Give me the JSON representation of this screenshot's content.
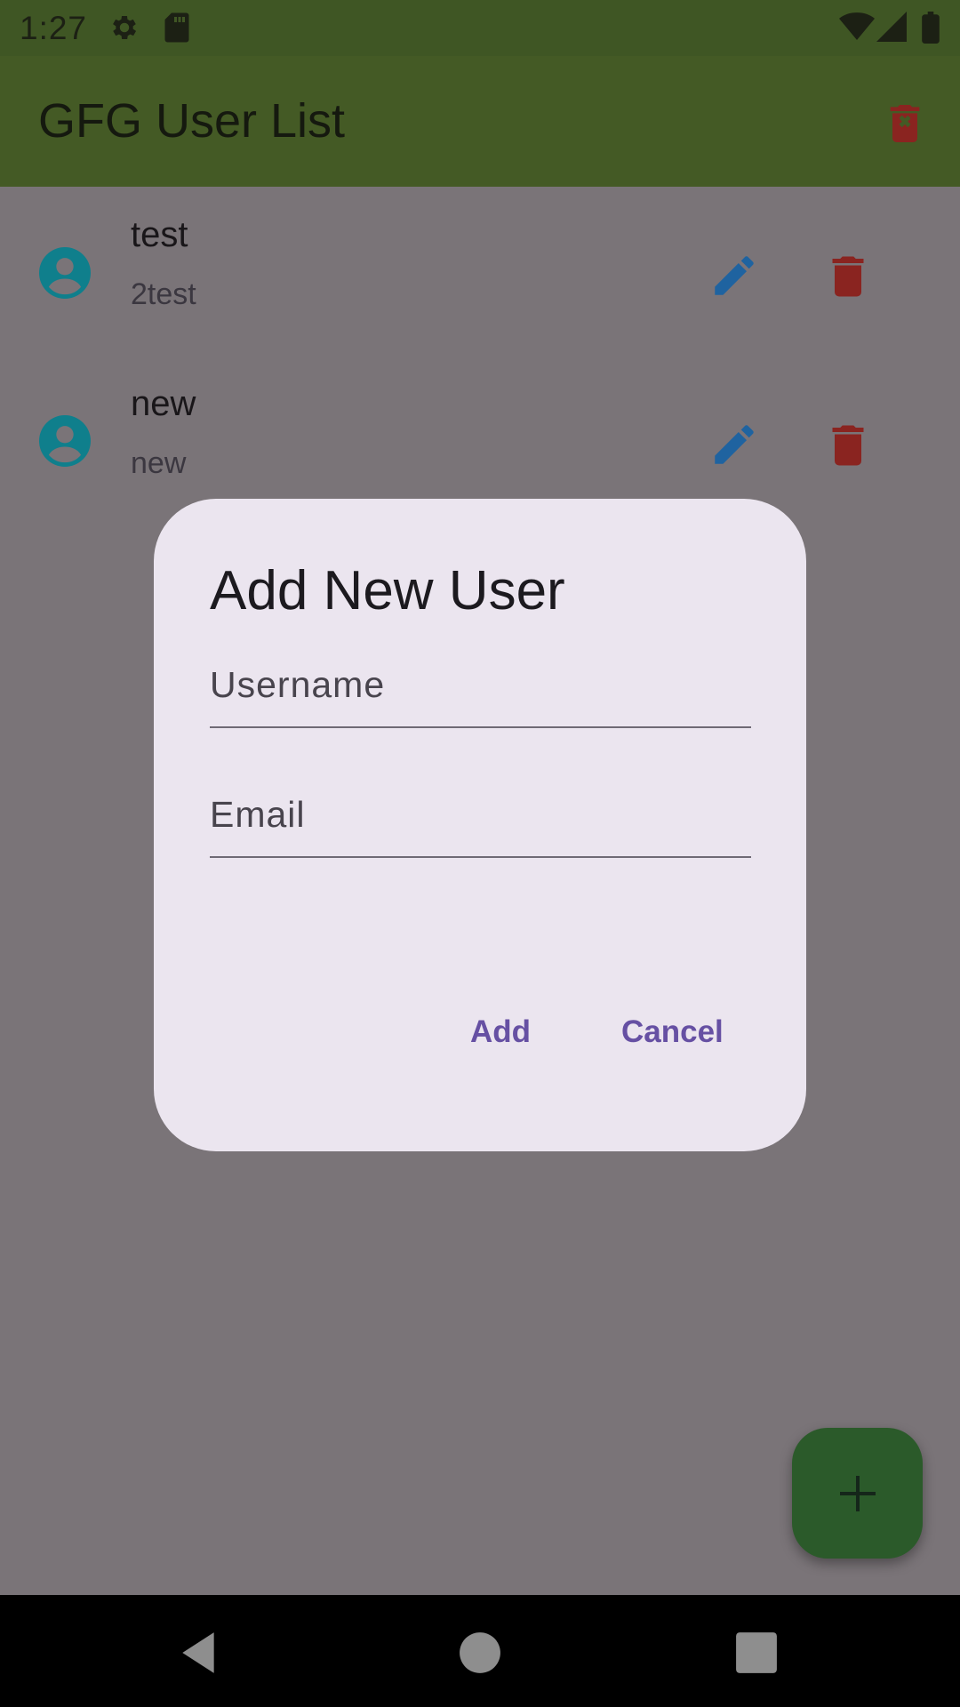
{
  "status_bar": {
    "time": "1:27",
    "icons": [
      "settings-icon",
      "sd-card-icon",
      "wifi-icon",
      "cellular-icon",
      "battery-icon"
    ]
  },
  "app_bar": {
    "title": "GFG User List",
    "action_icon": "delete-all-icon"
  },
  "users": [
    {
      "name": "test",
      "email": "2test"
    },
    {
      "name": "new",
      "email": "new"
    }
  ],
  "dialog": {
    "title": "Add New User",
    "username_label": "Username",
    "email_label": "Email",
    "add_label": "Add",
    "cancel_label": "Cancel"
  },
  "fab": {
    "icon": "add-icon"
  },
  "nav": {
    "icons": [
      "back-icon",
      "home-icon",
      "recents-icon"
    ]
  },
  "colors": {
    "app_bar": "#445a25",
    "scrim_background": "#7a7478",
    "avatar": "#0f7f8c",
    "edit": "#1f63a0",
    "delete": "#8a2420",
    "dialog_surface": "#ebe5ef",
    "dialog_button": "#6650a3",
    "fab": "#2b5a2a"
  }
}
